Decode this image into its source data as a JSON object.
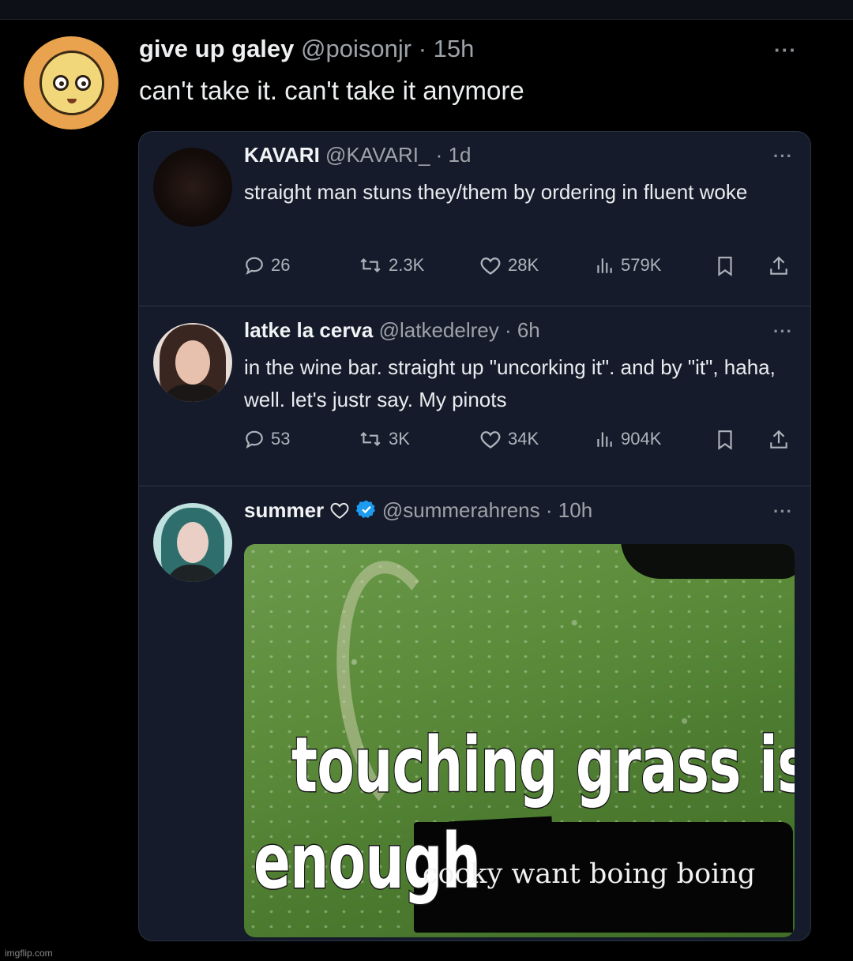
{
  "main_tweet": {
    "display_name": "give up galey",
    "handle": "@poisonjr",
    "time": "· 15h",
    "text": "can't take it. can't take it anymore",
    "more": "···"
  },
  "quotes": [
    {
      "display_name": "KAVARI",
      "handle": "@KAVARI_",
      "time": "· 1d",
      "text": "straight man stuns they/them by ordering in fluent woke",
      "replies": "26",
      "reposts": "2.3K",
      "likes": "28K",
      "views": "579K",
      "more": "···"
    },
    {
      "display_name": "latke la cerva",
      "handle": "@latkedelrey",
      "time": "· 6h",
      "text": "in the wine bar. straight up \"uncorking it\". and by \"it\", haha, well. let's justr say. My pinots",
      "replies": "53",
      "reposts": "3K",
      "likes": "34K",
      "views": "904K",
      "more": "···"
    },
    {
      "display_name": "summer",
      "handle": "@summerahrens",
      "time": "· 10h",
      "more": "···",
      "meme": {
        "line1": "touching grass is not",
        "line2": "enough",
        "overlay": "cocky want boing boing"
      }
    }
  ],
  "watermark": "imgflip.com",
  "colors": {
    "background": "#000000",
    "card": "#151b2a",
    "muted_text": "#9ea3a9",
    "verified_badge": "#1d9bf0"
  },
  "icons": [
    "reply-icon",
    "repost-icon",
    "like-icon",
    "views-icon",
    "bookmark-icon",
    "share-icon",
    "verified-icon",
    "more-icon"
  ]
}
